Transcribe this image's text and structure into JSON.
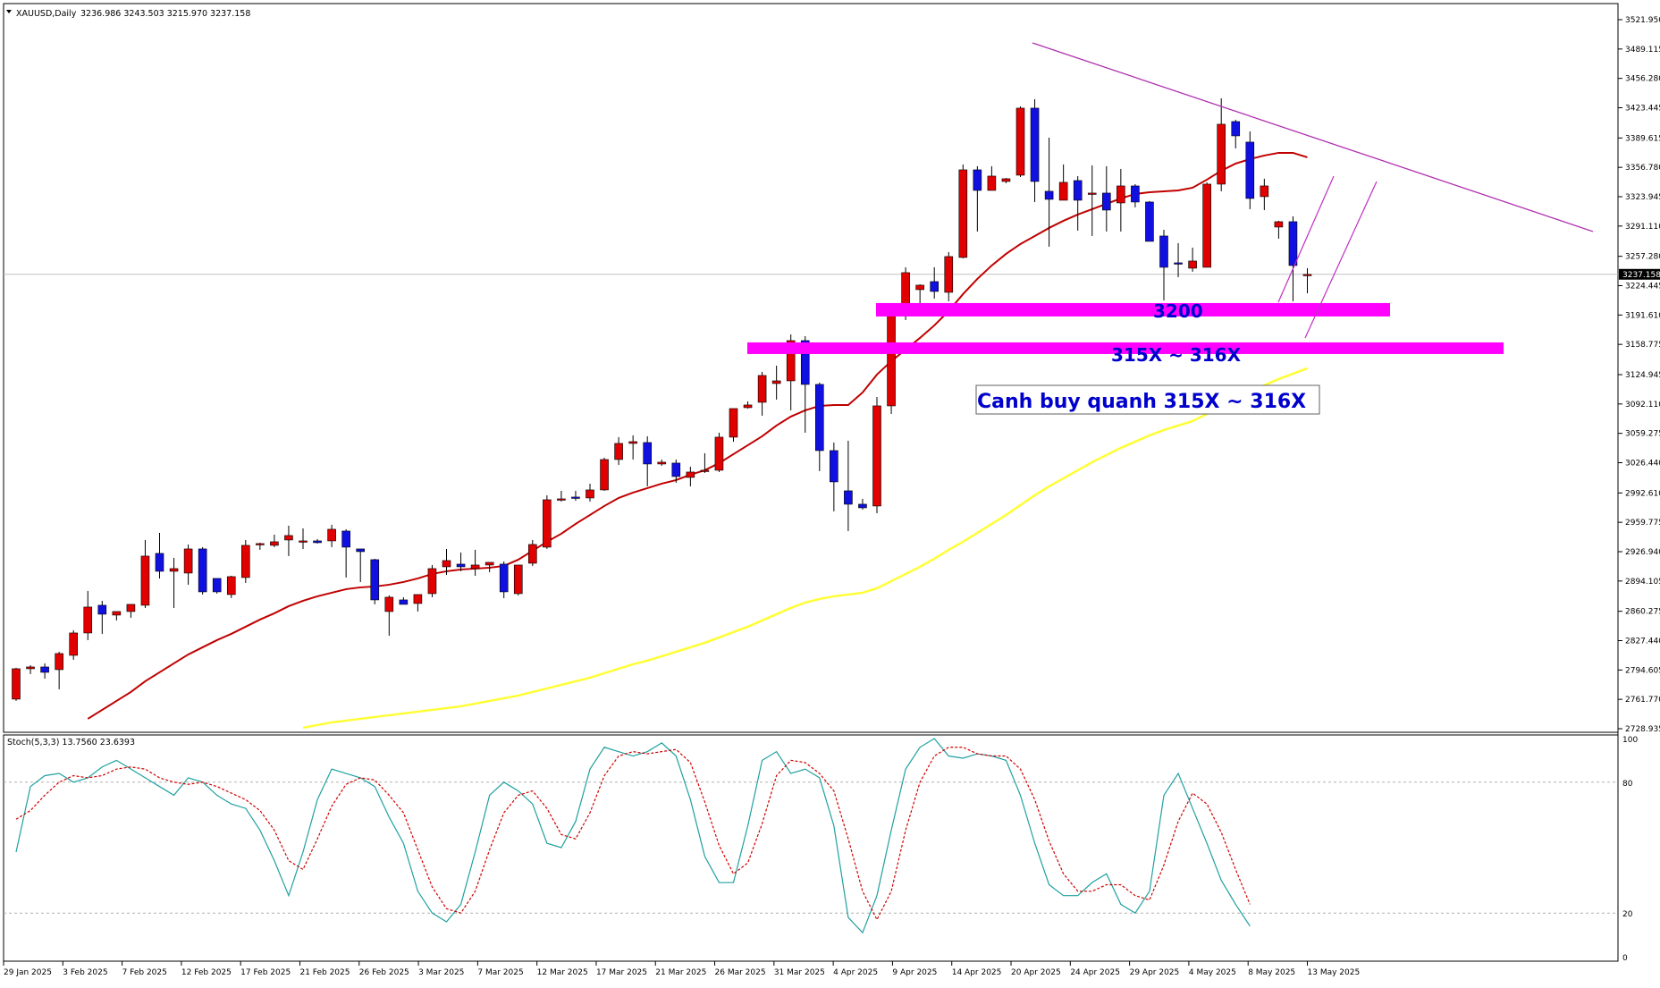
{
  "header": {
    "symbol": "XAUUSD,Daily",
    "ohlc": "3236.986 3243.503 3215.970 3237.158",
    "stoch_label": "Stoch(5,3,3) 13.7560 23.6393"
  },
  "colors": {
    "bull": "#e00000",
    "bear": "#1010e0",
    "ma_fast": "#c00000",
    "ma_slow": "#ffff33",
    "zone": "#ff00ff",
    "trendline": "#b030b0",
    "stoch_main": "#20a0a0",
    "stoch_signal": "#d00000",
    "annotation_text": "#0000cc"
  },
  "price_axis": {
    "ticks": [
      "3521.950",
      "3489.115",
      "3456.280",
      "3423.445",
      "3389.615",
      "3356.780",
      "3323.945",
      "3291.110",
      "3257.280",
      "3224.445",
      "3191.610",
      "3158.775",
      "3124.945",
      "3092.110",
      "3059.275",
      "3026.440",
      "2992.610",
      "2959.775",
      "2926.940",
      "2894.105",
      "2860.275",
      "2827.440",
      "2794.605",
      "2761.770",
      "2728.935"
    ],
    "current_price": "3237.158"
  },
  "stoch_axis": {
    "ticks": [
      "100",
      "80",
      "20",
      "0"
    ]
  },
  "date_axis": {
    "labels": [
      "29 Jan 2025",
      "3 Feb 2025",
      "7 Feb 2025",
      "12 Feb 2025",
      "17 Feb 2025",
      "21 Feb 2025",
      "26 Feb 2025",
      "3 Mar 2025",
      "7 Mar 2025",
      "12 Mar 2025",
      "17 Mar 2025",
      "21 Mar 2025",
      "26 Mar 2025",
      "31 Mar 2025",
      "4 Apr 2025",
      "9 Apr 2025",
      "14 Apr 2025",
      "20 Apr 2025",
      "24 Apr 2025",
      "29 Apr 2025",
      "4 May 2025",
      "8 May 2025",
      "13 May 2025"
    ]
  },
  "annotations": {
    "zone_3200": "3200",
    "zone_315x": "315X ~ 316X",
    "note": "Canh buy quanh 315X ~ 316X"
  },
  "chart_data": [
    {
      "type": "candlestick",
      "symbol": "XAUUSD",
      "timeframe": "Daily",
      "ylim": [
        2728.935,
        3521.95
      ],
      "ohlc": [
        [
          2762,
          2797,
          2760,
          2796
        ],
        [
          2796,
          2800,
          2790,
          2798
        ],
        [
          2798,
          2802,
          2785,
          2792
        ],
        [
          2795,
          2815,
          2773,
          2813
        ],
        [
          2811,
          2839,
          2806,
          2836
        ],
        [
          2836,
          2883,
          2828,
          2865
        ],
        [
          2867,
          2872,
          2835,
          2857
        ],
        [
          2856,
          2860,
          2850,
          2860
        ],
        [
          2860,
          2866,
          2853,
          2868
        ],
        [
          2867,
          2940,
          2864,
          2922
        ],
        [
          2925,
          2948,
          2897,
          2905
        ],
        [
          2905,
          2920,
          2864,
          2908
        ],
        [
          2903,
          2935,
          2890,
          2930
        ],
        [
          2930,
          2932,
          2879,
          2882
        ],
        [
          2897,
          2886,
          2880,
          2882
        ],
        [
          2879,
          2900,
          2875,
          2899
        ],
        [
          2898,
          2940,
          2892,
          2934
        ],
        [
          2935,
          2937,
          2929,
          2936
        ],
        [
          2934,
          2946,
          2932,
          2938
        ],
        [
          2940,
          2956,
          2922,
          2945
        ],
        [
          2939,
          2953,
          2930,
          2939
        ],
        [
          2939,
          2941,
          2936,
          2937
        ],
        [
          2939,
          2957,
          2932,
          2952
        ],
        [
          2950,
          2952,
          2898,
          2932
        ],
        [
          2930,
          2930,
          2893,
          2927
        ],
        [
          2918,
          2919,
          2868,
          2873
        ],
        [
          2860,
          2878,
          2833,
          2876
        ],
        [
          2873,
          2876,
          2871,
          2868
        ],
        [
          2869,
          2874,
          2860,
          2879
        ],
        [
          2880,
          2912,
          2876,
          2908
        ],
        [
          2910,
          2930,
          2901,
          2917
        ],
        [
          2913,
          2926,
          2905,
          2910
        ],
        [
          2908,
          2929,
          2900,
          2912
        ],
        [
          2912,
          2914,
          2904,
          2915
        ],
        [
          2913,
          2916,
          2875,
          2882
        ],
        [
          2880,
          2910,
          2878,
          2912
        ],
        [
          2914,
          2940,
          2911,
          2935
        ],
        [
          2932,
          2990,
          2930,
          2985
        ],
        [
          2985,
          2995,
          2983,
          2986
        ],
        [
          2988,
          2995,
          2984,
          2987
        ],
        [
          2987,
          3003,
          2983,
          2996
        ],
        [
          2996,
          3032,
          2995,
          3030
        ],
        [
          3030,
          3055,
          3024,
          3048
        ],
        [
          3048,
          3057,
          3030,
          3050
        ],
        [
          3049,
          3056,
          3000,
          3025
        ],
        [
          3025,
          3030,
          3023,
          3027
        ],
        [
          3026,
          3030,
          3004,
          3011
        ],
        [
          3010,
          3022,
          3000,
          3016
        ],
        [
          3017,
          3037,
          3015,
          3018
        ],
        [
          3018,
          3060,
          3016,
          3055
        ],
        [
          3055,
          3085,
          3050,
          3087
        ],
        [
          3088,
          3095,
          3087,
          3091
        ],
        [
          3094,
          3128,
          3079,
          3124
        ],
        [
          3115,
          3135,
          3097,
          3118
        ],
        [
          3118,
          3170,
          3085,
          3163
        ],
        [
          3163,
          3168,
          3060,
          3114
        ],
        [
          3114,
          3116,
          3017,
          3040
        ],
        [
          3040,
          3049,
          2972,
          3005
        ],
        [
          2995,
          3051,
          2950,
          2980
        ],
        [
          2980,
          2986,
          2974,
          2976
        ],
        [
          2978,
          3100,
          2970,
          3090
        ],
        [
          3090,
          3198,
          3081,
          3194
        ],
        [
          3194,
          3245,
          3186,
          3239
        ],
        [
          3220,
          3226,
          3200,
          3225
        ],
        [
          3229,
          3245,
          3210,
          3218
        ],
        [
          3217,
          3262,
          3207,
          3257
        ],
        [
          3256,
          3360,
          3255,
          3354
        ],
        [
          3354,
          3358,
          3285,
          3331
        ],
        [
          3331,
          3358,
          3331,
          3347
        ],
        [
          3341,
          3345,
          3339,
          3344
        ],
        [
          3348,
          3425,
          3346,
          3423
        ],
        [
          3423,
          3433,
          3318,
          3341
        ],
        [
          3330,
          3390,
          3268,
          3321
        ],
        [
          3320,
          3360,
          3320,
          3340
        ],
        [
          3342,
          3347,
          3286,
          3320
        ],
        [
          3328,
          3359,
          3280,
          3328
        ],
        [
          3328,
          3358,
          3285,
          3309
        ],
        [
          3317,
          3355,
          3285,
          3336
        ],
        [
          3336,
          3338,
          3312,
          3318
        ],
        [
          3318,
          3319,
          3285,
          3274
        ],
        [
          3280,
          3287,
          3208,
          3245
        ],
        [
          3250,
          3272,
          3234,
          3249
        ],
        [
          3244,
          3267,
          3240,
          3252
        ],
        [
          3245,
          3340,
          3245,
          3338
        ],
        [
          3338,
          3434,
          3330,
          3405
        ],
        [
          3408,
          3410,
          3378,
          3392
        ],
        [
          3385,
          3397,
          3310,
          3322
        ],
        [
          3324,
          3344,
          3309,
          3336
        ],
        [
          3290,
          3297,
          3277,
          3296
        ],
        [
          3296,
          3302,
          3207,
          3247
        ],
        [
          3237,
          3244,
          3216,
          3237
        ]
      ],
      "moving_averages": [
        {
          "values": [
            2680,
            2692,
            2704,
            2716,
            2728,
            2740,
            2750,
            2760,
            2770,
            2782,
            2792,
            2802,
            2812,
            2820,
            2828,
            2835,
            2843,
            2851,
            2858,
            2866,
            2872,
            2877,
            2881,
            2885,
            2887,
            2888,
            2890,
            2893,
            2897,
            2902,
            2905,
            2907,
            2908,
            2909,
            2911,
            2918,
            2928,
            2938,
            2947,
            2958,
            2968,
            2978,
            2987,
            2993,
            2998,
            3003,
            3007,
            3013,
            3018,
            3026,
            3036,
            3046,
            3056,
            3068,
            3078,
            3085,
            3090,
            3091,
            3091,
            3105,
            3125,
            3140,
            3153,
            3166,
            3180,
            3196,
            3215,
            3232,
            3247,
            3260,
            3271,
            3280,
            3289,
            3297,
            3304,
            3310,
            3316,
            3322,
            3327,
            3329,
            3330,
            3331,
            3334,
            3343,
            3353,
            3361,
            3366,
            3370,
            3373,
            3373,
            3368
          ]
        },
        {
          "values": [
            2635,
            2640,
            2646,
            2652,
            2657,
            2663,
            2669,
            2674,
            2680,
            2686,
            2690,
            2695,
            2700,
            2704,
            2708,
            2712,
            2716,
            2720,
            2724,
            2727,
            2730,
            2733,
            2736,
            2738,
            2740,
            2742,
            2744,
            2746,
            2748,
            2750,
            2752,
            2754,
            2757,
            2760,
            2763,
            2766,
            2770,
            2774,
            2778,
            2782,
            2786,
            2791,
            2796,
            2801,
            2805,
            2810,
            2815,
            2820,
            2825,
            2831,
            2837,
            2843,
            2850,
            2857,
            2864,
            2870,
            2874,
            2877,
            2879,
            2881,
            2886,
            2894,
            2902,
            2910,
            2919,
            2929,
            2938,
            2948,
            2958,
            2968,
            2979,
            2990,
            3000,
            3009,
            3018,
            3027,
            3035,
            3043,
            3050,
            3057,
            3063,
            3068,
            3073,
            3081,
            3090,
            3098,
            3106,
            3113,
            3120,
            3126,
            3132
          ]
        }
      ],
      "resistance_line": {
        "from": [
          "20 Apr 2025",
          3496
        ],
        "to": [
          "21 May 2025",
          3285
        ]
      },
      "zones": [
        {
          "label": "3200",
          "low": 3190,
          "high": 3205
        },
        {
          "label": "315X ~ 316X",
          "low": 3148,
          "high": 3161
        }
      ]
    },
    {
      "type": "line",
      "title": "Stoch(5,3,3) 13.7560 23.6393",
      "ylim": [
        0,
        100
      ],
      "levels": [
        20,
        80
      ],
      "series": [
        {
          "values": [
            48,
            78,
            83,
            84,
            80,
            82,
            87,
            90,
            86,
            82,
            78,
            74,
            82,
            80,
            74,
            70,
            68,
            58,
            44,
            28,
            48,
            72,
            86,
            84,
            82,
            78,
            64,
            52,
            30,
            20,
            16,
            24,
            48,
            74,
            80,
            76,
            70,
            52,
            50,
            62,
            86,
            96,
            94,
            92,
            94,
            98,
            92,
            72,
            46,
            34,
            34,
            60,
            90,
            94,
            84,
            86,
            82,
            60,
            18,
            11,
            28,
            58,
            86,
            96,
            100,
            92,
            91,
            93,
            92,
            90,
            74,
            52,
            33,
            28,
            28,
            34,
            38,
            24,
            20,
            30,
            74,
            84,
            68,
            52,
            35,
            24,
            14
          ]
        },
        {
          "values": [
            63,
            67,
            74,
            80,
            83,
            82,
            83,
            86,
            87,
            86,
            82,
            80,
            79,
            80,
            78,
            75,
            72,
            67,
            58,
            44,
            40,
            54,
            69,
            79,
            82,
            81,
            74,
            66,
            49,
            32,
            22,
            20,
            30,
            49,
            66,
            74,
            76,
            68,
            56,
            54,
            66,
            83,
            92,
            94,
            93,
            94,
            95,
            89,
            71,
            51,
            38,
            43,
            61,
            83,
            90,
            89,
            84,
            76,
            54,
            30,
            17,
            30,
            58,
            80,
            92,
            96,
            96,
            93,
            92,
            92,
            86,
            72,
            53,
            38,
            30,
            30,
            33,
            33,
            28,
            26,
            42,
            62,
            75,
            70,
            57,
            40,
            24
          ]
        }
      ]
    }
  ]
}
